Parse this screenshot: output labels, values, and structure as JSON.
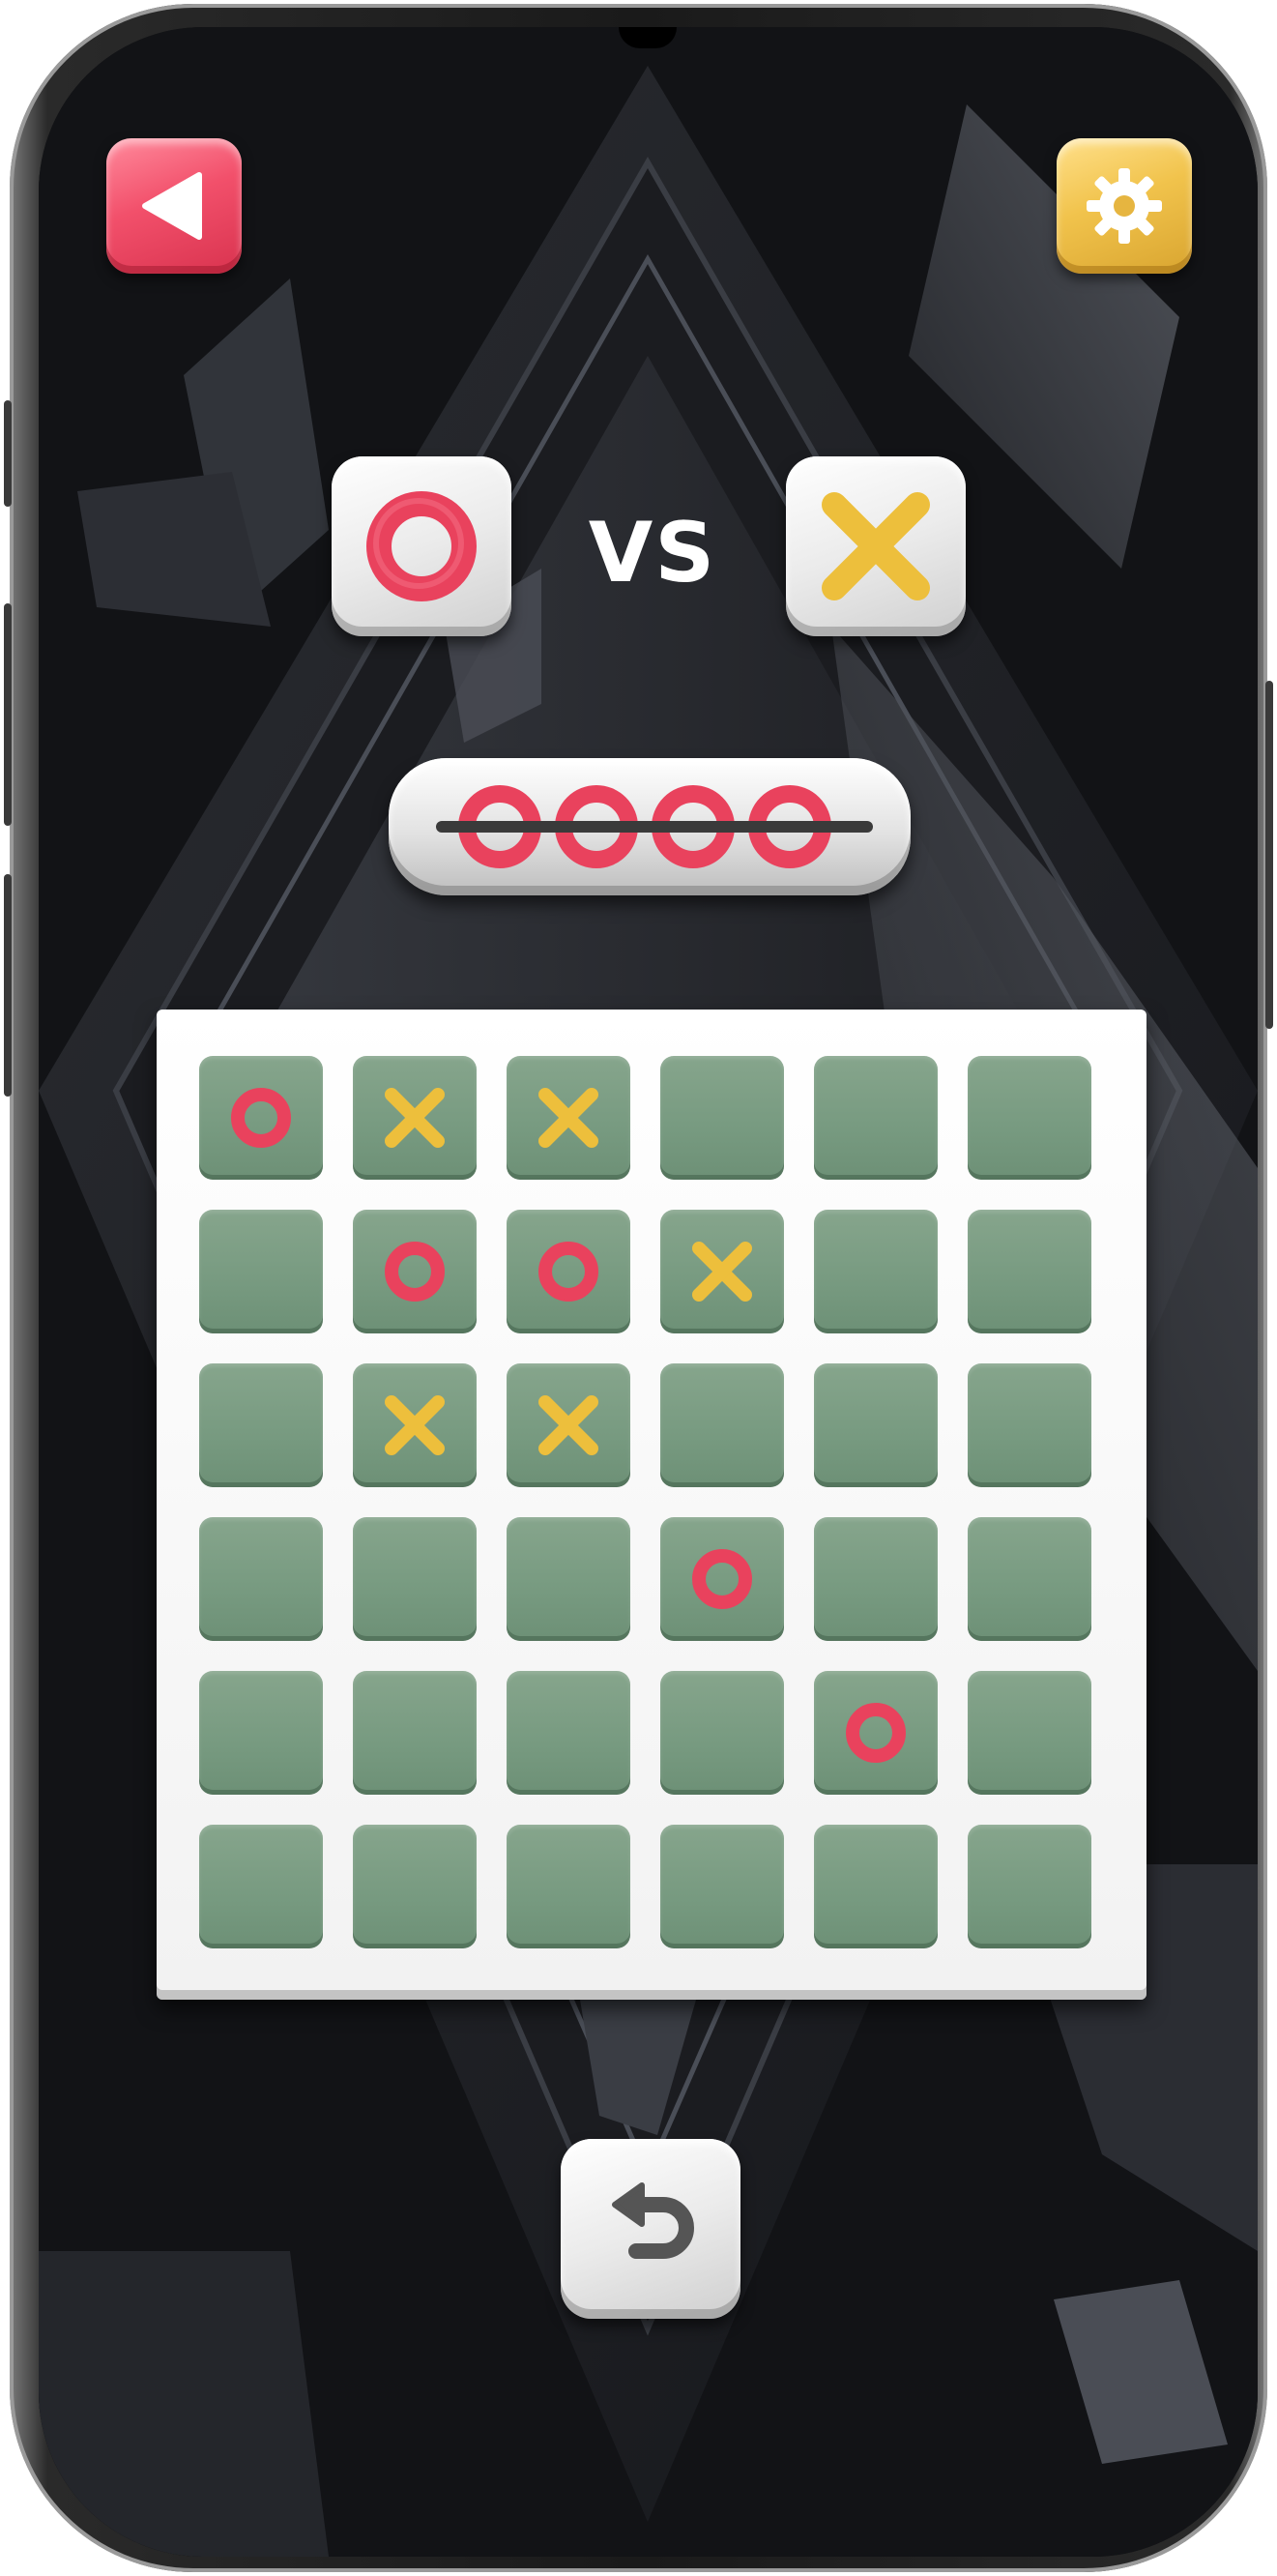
{
  "players": {
    "player1": {
      "symbol": "O",
      "icon": "ring-o-icon"
    },
    "vs_label": "VS",
    "player2": {
      "symbol": "X",
      "icon": "cross-x-icon"
    }
  },
  "win_condition": {
    "count": 4,
    "symbol": "O",
    "icon": "four-in-a-row-icon"
  },
  "toolbar": {
    "back_icon": "back-triangle-icon",
    "settings_icon": "gear-icon",
    "undo_icon": "undo-arrow-icon"
  },
  "board": {
    "size": 6,
    "rows": [
      [
        "O",
        "X",
        "X",
        "",
        "",
        ""
      ],
      [
        "",
        "O",
        "O",
        "X",
        "",
        ""
      ],
      [
        "",
        "X",
        "X",
        "",
        "",
        ""
      ],
      [
        "",
        "",
        "",
        "O",
        "",
        ""
      ],
      [
        "",
        "",
        "",
        "",
        "O",
        ""
      ],
      [
        "",
        "",
        "",
        "",
        "",
        ""
      ]
    ]
  },
  "colors": {
    "o_mark": "#e9425d",
    "x_mark": "#edbf3c",
    "cell": "#779a80",
    "board": "#f2f2f2",
    "back_button": "#f2506b",
    "settings_button": "#f1c34c"
  }
}
